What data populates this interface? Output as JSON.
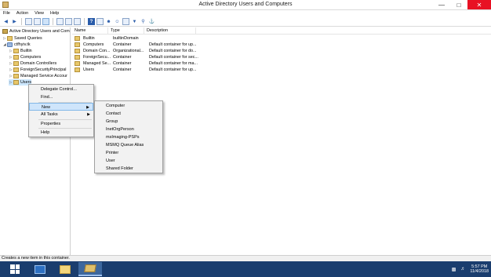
{
  "window": {
    "title": "Active Directory Users and Computers"
  },
  "menu": [
    "File",
    "Action",
    "View",
    "Help"
  ],
  "tree": {
    "root": "Active Directory Users and Com",
    "items": [
      {
        "label": "Saved Queries",
        "icon": "folder"
      },
      {
        "label": "ctfhyiv.tk",
        "icon": "domain"
      },
      {
        "label": "Builtin",
        "icon": "folder"
      },
      {
        "label": "Computers",
        "icon": "folder"
      },
      {
        "label": "Domain Controllers",
        "icon": "folder"
      },
      {
        "label": "ForeignSecurityPrincipal",
        "icon": "folder"
      },
      {
        "label": "Managed Service Accour",
        "icon": "folder"
      },
      {
        "label": "Users",
        "icon": "folder"
      }
    ]
  },
  "list": {
    "columns": [
      "Name",
      "Type",
      "Description"
    ],
    "rows": [
      {
        "name": "Builtin",
        "type": "builtinDomain",
        "description": ""
      },
      {
        "name": "Computers",
        "type": "Container",
        "description": "Default container for up..."
      },
      {
        "name": "Domain Con...",
        "type": "Organizational...",
        "description": "Default container for do..."
      },
      {
        "name": "ForeignSecu...",
        "type": "Container",
        "description": "Default container for sec..."
      },
      {
        "name": "Managed Se...",
        "type": "Container",
        "description": "Default container for ma..."
      },
      {
        "name": "Users",
        "type": "Container",
        "description": "Default container for up..."
      }
    ]
  },
  "context_menu": {
    "items": [
      {
        "label": "Delegate Control..."
      },
      {
        "label": "Find..."
      },
      {
        "label": "New",
        "has_submenu": true,
        "highlighted": true
      },
      {
        "label": "All Tasks",
        "has_submenu": true
      },
      {
        "label": "Properties"
      },
      {
        "label": "Help"
      }
    ]
  },
  "submenu": {
    "items": [
      "Computer",
      "Contact",
      "Group",
      "InetOrgPerson",
      "msImaging-PSPs",
      "MSMQ Queue Alias",
      "Printer",
      "User",
      "Shared Folder"
    ]
  },
  "status": "Creates a new item in this container.",
  "clock": {
    "time": "5:57 PM",
    "date": "11/4/2018"
  },
  "colors": {
    "taskbar": "#1a3d6e",
    "highlight": "#cfe5fb",
    "close": "#e81123"
  }
}
